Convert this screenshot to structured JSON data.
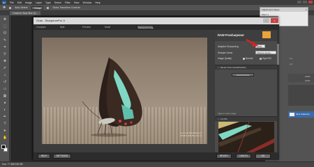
{
  "menubar": {
    "logo": "Ps",
    "items": [
      "File",
      "Edit",
      "Image",
      "Layer",
      "Type",
      "Select",
      "Filter",
      "View",
      "Window",
      "Help"
    ]
  },
  "options": {
    "auto_select": "Auto-Select:",
    "layer_value": "Group",
    "show_transform": "Show Transform Controls"
  },
  "doc_tab": "Customer Bear Blue (1)...",
  "status": "Doc: 77,6M/146,9M",
  "dialog": {
    "title": "Grab - SharpenerPro 3",
    "subbar": {
      "compare": "Compare",
      "split": "Split",
      "preview": "Preview",
      "mode_label": "Mode",
      "mode_value": "Sharpened Image"
    },
    "photo_credit": [
      "Common Bluebottle (L)",
      "1/8 ISO 400 f/8 +0.3 ev"
    ],
    "bottom": {
      "help": "HELP",
      "settings": "SETTINGS",
      "brush": "BRUSH",
      "cancel": "CANCEL",
      "ok": "OK"
    }
  },
  "panel": {
    "brand": "RAW Presharpener",
    "adaptive_label": "Adaptive Sharpening",
    "adaptive_value": "100%",
    "sharpen_areas_label": "Sharpen Areas",
    "sharpen_areas_value": "Sharpen Entire...",
    "image_quality_label": "Image Quality:",
    "quality_normal": "Normal",
    "quality_high": "High ISO",
    "selective_header": "SELECTIVE SHARPENING",
    "control_points": "Control Points",
    "apply_entire": "Apply to entire image",
    "loupe_header": "LOUPE"
  },
  "navigator": {
    "title": "Adjustments Styles",
    "body": "Effect 1"
  },
  "right_panels": {
    "layer_name": "New Collection",
    "labels": [
      "it 1",
      "e 2",
      "100%",
      "100%"
    ]
  },
  "colors": {
    "dialog_bg": "#3a3a3a",
    "accent_arrow": "#e02020",
    "butterfly_turquoise": "#7fd8c4",
    "layer_selected": "#3a6aa8"
  }
}
